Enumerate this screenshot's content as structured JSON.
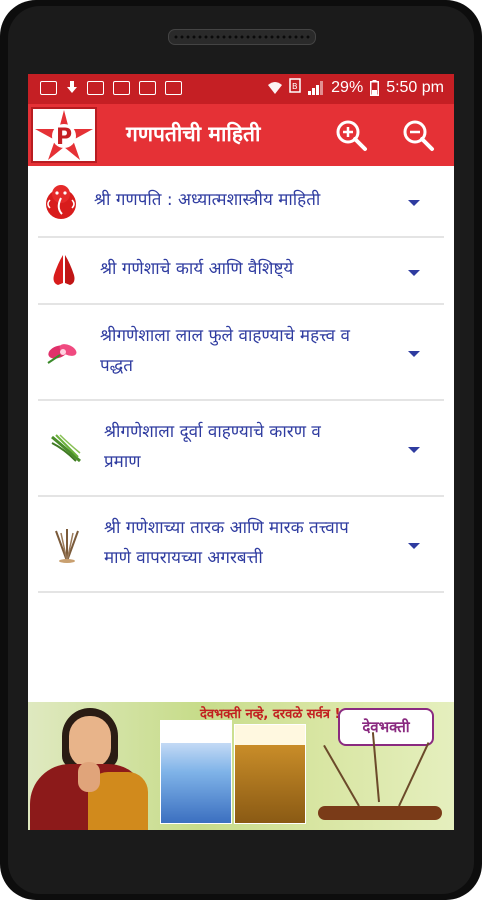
{
  "status_bar": {
    "battery": "29%",
    "time": "5:50 pm"
  },
  "app_bar": {
    "title": "गणपतीची माहिती",
    "logo_letter": "P"
  },
  "list": {
    "items": [
      {
        "icon": "ganesha-icon",
        "lines": [
          "श्री गणपति : अध्यात्मशास्त्रीय माहिती"
        ]
      },
      {
        "icon": "namaste-icon",
        "lines": [
          "श्री गणेशाचे कार्य आणि वैशिष्ट्ये"
        ]
      },
      {
        "icon": "red-flower-icon",
        "lines": [
          "श्रीगणेशाला लाल फुले वाहण्याचे महत्त्व व",
          "पद्धत"
        ]
      },
      {
        "icon": "durva-grass-icon",
        "lines": [
          "श्रीगणेशाला दूर्वा वाहण्याचे कारण व",
          "प्रमाण"
        ]
      },
      {
        "icon": "incense-sticks-icon",
        "lines": [
          "श्री गणेशाच्या तारक आणि मारक तत्त्वाप",
          "माणे वापरायच्या अगरबत्ती"
        ]
      }
    ]
  },
  "ad": {
    "slogan": "देवभक्ती नव्हे, दरवळे सर्वत्र !",
    "brand": "देवभक्ती"
  },
  "colors": {
    "status_bar": "#c51f24",
    "app_bar": "#e53136",
    "link_text": "#2f3ca0"
  }
}
